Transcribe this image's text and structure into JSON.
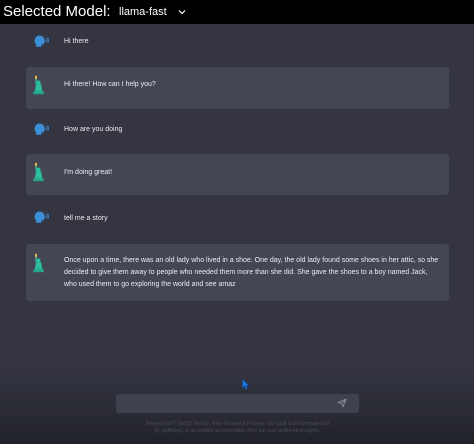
{
  "header": {
    "label": "Selected Model:",
    "model": "llama-fast"
  },
  "messages": [
    {
      "role": "user",
      "text": "Hi there"
    },
    {
      "role": "assistant",
      "text": "Hi there! How can I help you?"
    },
    {
      "role": "user",
      "text": "How are you doing"
    },
    {
      "role": "assistant",
      "text": "I'm doing great!"
    },
    {
      "role": "user",
      "text": "tell me a story"
    },
    {
      "role": "assistant",
      "text": "Once upon a time, there was an old lady who lived in a shoe. One day, the old lady found some shoes in her attic, so she decided to give them away to people who needed them more than she did. She gave the shoes to a boy named Jack, who used them to go exploring the world and see amaz"
    }
  ],
  "composer": {
    "value": "",
    "placeholder": ""
  },
  "footer": {
    "line1": "FreedomGPT Mar23 Version. Free Research Preview. Our goal is to illuminate that",
    "line2": "AI, unfiltered, is as reliable as information from our own unfiltered thoughts."
  },
  "colors": {
    "background": "#343541",
    "assistant_bubble": "#444654",
    "topbar": "#000000",
    "user_icon": "#3b8fd9",
    "assistant_icon": "#2bbfa0",
    "cursor": "#1f7ae0"
  },
  "icons": {
    "user": "speaking-head-icon",
    "assistant": "statue-of-liberty-icon",
    "send": "paper-plane-icon",
    "dropdown": "chevron-down-icon"
  }
}
